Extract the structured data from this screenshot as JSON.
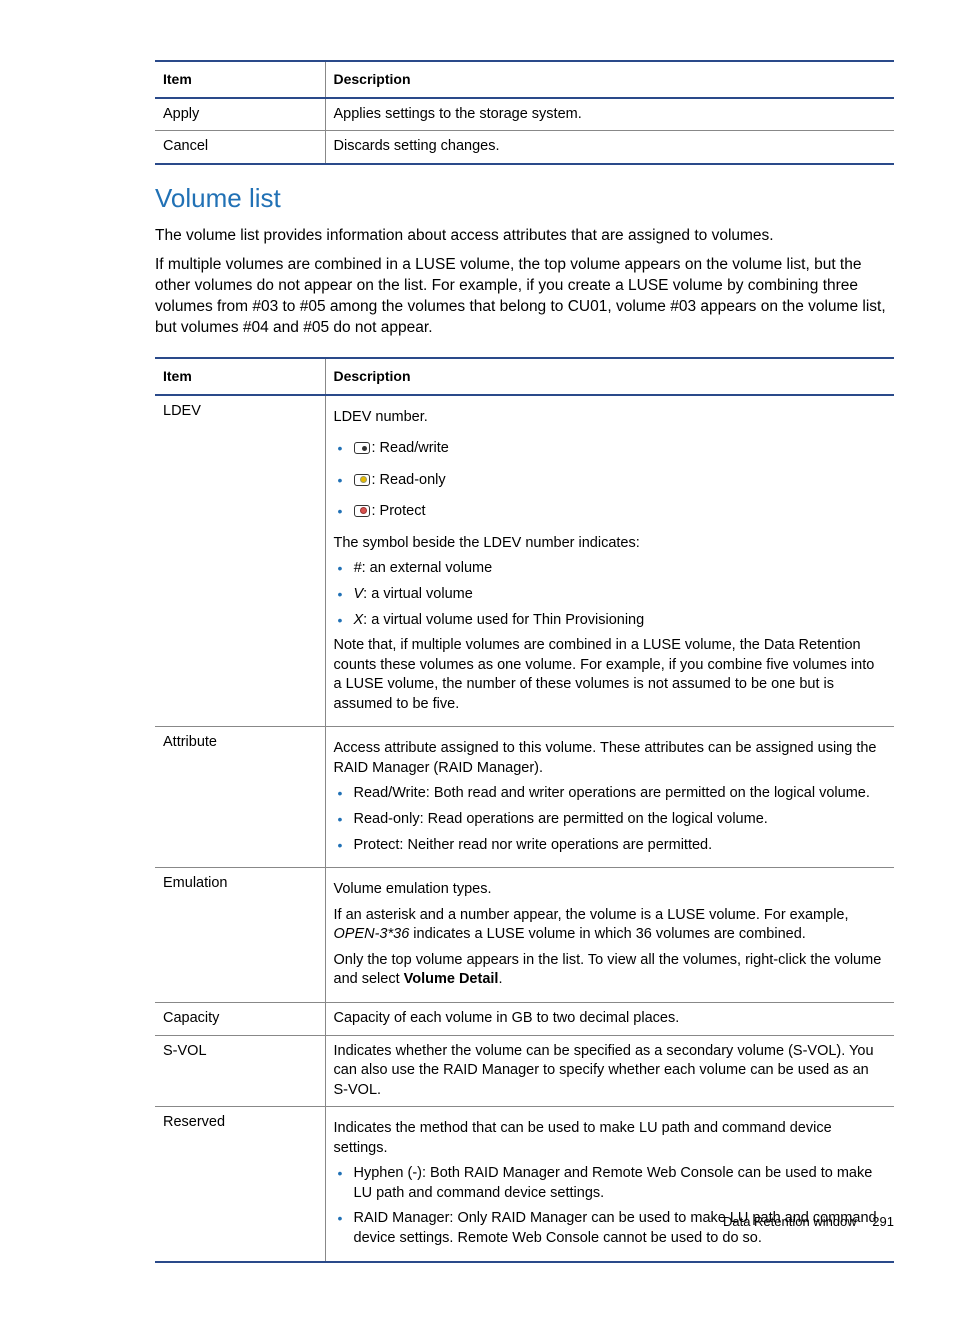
{
  "table1": {
    "headers": {
      "item": "Item",
      "description": "Description"
    },
    "rows": [
      {
        "item": "Apply",
        "desc": "Applies settings to the storage system."
      },
      {
        "item": "Cancel",
        "desc": "Discards setting changes."
      }
    ]
  },
  "heading": "Volume list",
  "intro_p1": "The volume list provides information about access attributes that are assigned to volumes.",
  "intro_p2": "If multiple volumes are combined in a LUSE volume, the top volume appears on the volume list, but the other volumes do not appear on the list. For example, if you create a LUSE volume by combining three volumes from #03 to #05 among the volumes that belong to CU01, volume #03 appears on the volume list, but volumes #04 and #05 do not appear.",
  "table2": {
    "headers": {
      "item": "Item",
      "description": "Description"
    },
    "ldev": {
      "label": "LDEV",
      "line1": "LDEV number.",
      "icon_labels": {
        "rw": ": Read/write",
        "ro": ": Read-only",
        "pr": ": Protect"
      },
      "line2": "The symbol beside the LDEV number indicates:",
      "symbols": [
        {
          "sym": "#",
          "text": ": an external volume"
        },
        {
          "sym": "V",
          "text": ": a virtual volume"
        },
        {
          "sym": "X",
          "text": ": a virtual volume used for Thin Provisioning"
        }
      ],
      "note": "Note that, if multiple volumes are combined in a LUSE volume, the Data Retention counts these volumes as one volume. For example, if you combine five volumes into a LUSE volume, the number of these volumes is not assumed to be one but is assumed to be five."
    },
    "attribute": {
      "label": "Attribute",
      "line1": "Access attribute assigned to this volume. These attributes can be assigned using the RAID Manager (RAID Manager).",
      "bullets": [
        "Read/Write: Both read and writer operations are permitted on the logical volume.",
        "Read-only: Read operations are permitted on the logical volume.",
        "Protect: Neither read nor write operations are permitted."
      ]
    },
    "emulation": {
      "label": "Emulation",
      "line1": "Volume emulation types.",
      "line2a": "If an asterisk and a number appear, the volume is a LUSE volume. For example, ",
      "line2_em": "OPEN-3*36",
      "line2b": " indicates a LUSE volume in which 36 volumes are combined.",
      "line3a": "Only the top volume appears in the list. To view all the volumes, right-click the volume and select ",
      "line3_bold": "Volume Detail",
      "line3b": "."
    },
    "capacity": {
      "label": "Capacity",
      "desc": "Capacity of each volume in GB to two decimal places."
    },
    "svol": {
      "label": "S-VOL",
      "desc": "Indicates whether the volume can be specified as a secondary volume (S-VOL). You can also use the RAID Manager to specify whether each volume can be used as an S-VOL."
    },
    "reserved": {
      "label": "Reserved",
      "line1": "Indicates the method that can be used to make LU path and command device settings.",
      "bullets": [
        "Hyphen (-): Both RAID Manager and Remote Web Console can be used to make LU path and command device settings.",
        "RAID Manager: Only RAID Manager can be used to make LU path and command device settings. Remote Web Console cannot be used to do so."
      ]
    }
  },
  "footer": {
    "title": "Data Retention window",
    "page": "291"
  }
}
